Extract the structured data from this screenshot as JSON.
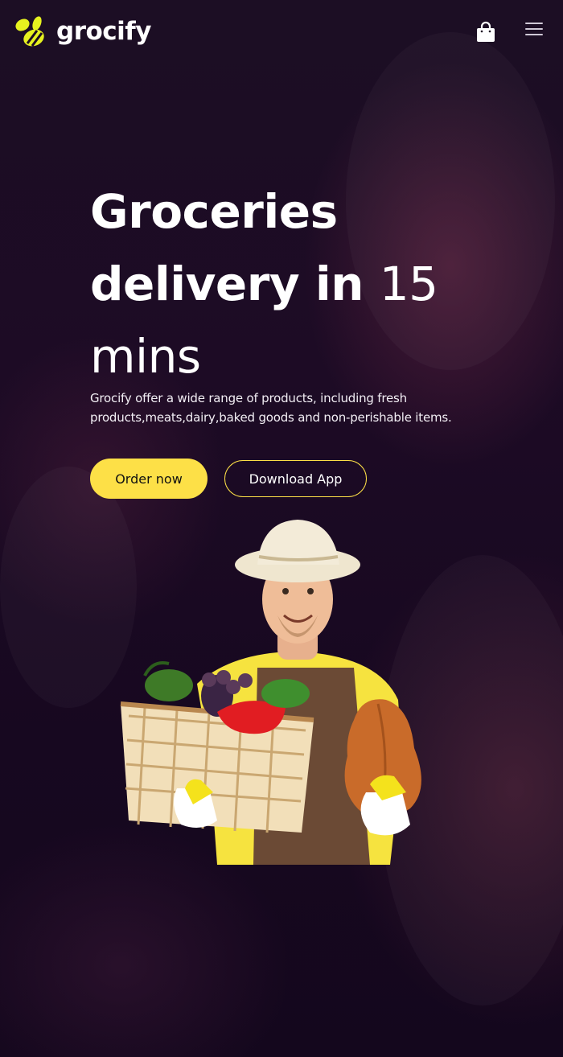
{
  "header": {
    "brand_name": "grocify",
    "logo_icon": "bee-logo-icon",
    "cart_icon": "shopping-bag-icon",
    "menu_icon": "hamburger-menu-icon"
  },
  "hero": {
    "title_line1": "Groceries",
    "title_line2_bold": "delivery in",
    "title_line2_light": "15",
    "title_line3": "mins",
    "description": "Grocify offer a wide range of products, including fresh products,meats,dairy,baked goods and non-perishable items.",
    "order_button": "Order now",
    "download_button": "Download App"
  },
  "colors": {
    "accent": "#fde047",
    "background": "#1c0e24",
    "text": "#ffffff"
  }
}
